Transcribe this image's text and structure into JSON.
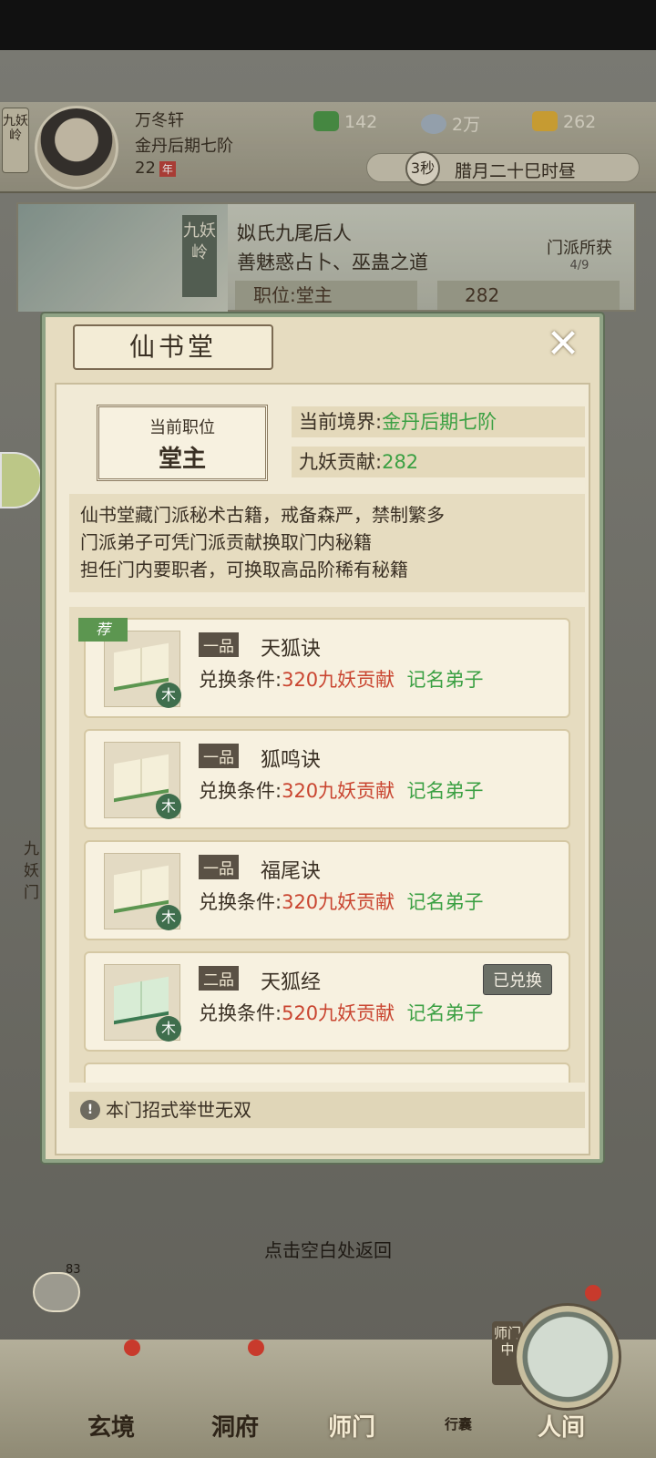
{
  "header": {
    "sect_tag": "九妖岭",
    "player_name": "万冬轩",
    "realm": "金丹后期七阶",
    "age": "22",
    "age_unit": "年",
    "resources": [
      {
        "icon": "jade-leaf-icon",
        "value": "142",
        "color": "#4f9a4a"
      },
      {
        "icon": "spirit-stone-icon",
        "value": "2万",
        "color": "#a8b6c3"
      },
      {
        "icon": "gold-ingot-icon",
        "value": "262",
        "color": "#e2b13a"
      }
    ],
    "timer_seconds": "3秒",
    "timer_text": "腊月二十巳时昼"
  },
  "sect_panel": {
    "vertical_name": "九妖岭",
    "desc_line1": "姒氏九尾后人",
    "desc_line2": "善魅惑占卜、巫蛊之道",
    "gain_label": "门派所获",
    "gain_count": "4/9",
    "position": "职位:堂主",
    "contribution": "282"
  },
  "side": {
    "vertical_text": "九妖门"
  },
  "modal": {
    "title": "仙书堂",
    "close_icon": "close-x-icon",
    "position_card": {
      "label": "当前职位",
      "value": "堂主"
    },
    "realm_label": "当前境界:",
    "realm_value": "金丹后期七阶",
    "contrib_label": "九妖贡献:",
    "contrib_value": "282",
    "description": [
      "仙书堂藏门派秘术古籍，戒备森严，禁制繁多",
      "门派弟子可凭门派贡献换取门内秘籍",
      "担任门内要职者，可换取高品阶稀有秘籍"
    ],
    "books": [
      {
        "rank": "一品",
        "name": "天狐诀",
        "cond_label": "兑换条件:",
        "cost": "320九妖贡献",
        "req": "记名弟子",
        "element": "木",
        "recommend": "荐",
        "exchanged": ""
      },
      {
        "rank": "一品",
        "name": "狐鸣诀",
        "cond_label": "兑换条件:",
        "cost": "320九妖贡献",
        "req": "记名弟子",
        "element": "木",
        "recommend": "",
        "exchanged": ""
      },
      {
        "rank": "一品",
        "name": "福尾诀",
        "cond_label": "兑换条件:",
        "cost": "320九妖贡献",
        "req": "记名弟子",
        "element": "木",
        "recommend": "",
        "exchanged": ""
      },
      {
        "rank": "二品",
        "name": "天狐经",
        "cond_label": "兑换条件:",
        "cost": "520九妖贡献",
        "req": "记名弟子",
        "element": "木",
        "recommend": "",
        "exchanged": "已兑换"
      }
    ],
    "tip": "本门招式举世无双"
  },
  "return_hint": "点击空白处返回",
  "chat": {
    "count": "83"
  },
  "bottom_nav": {
    "items": [
      {
        "label": "玄境"
      },
      {
        "label": "洞府"
      },
      {
        "label": "师门"
      },
      {
        "label": "行囊"
      },
      {
        "label": "人间"
      }
    ],
    "master_tag": "师门中"
  }
}
